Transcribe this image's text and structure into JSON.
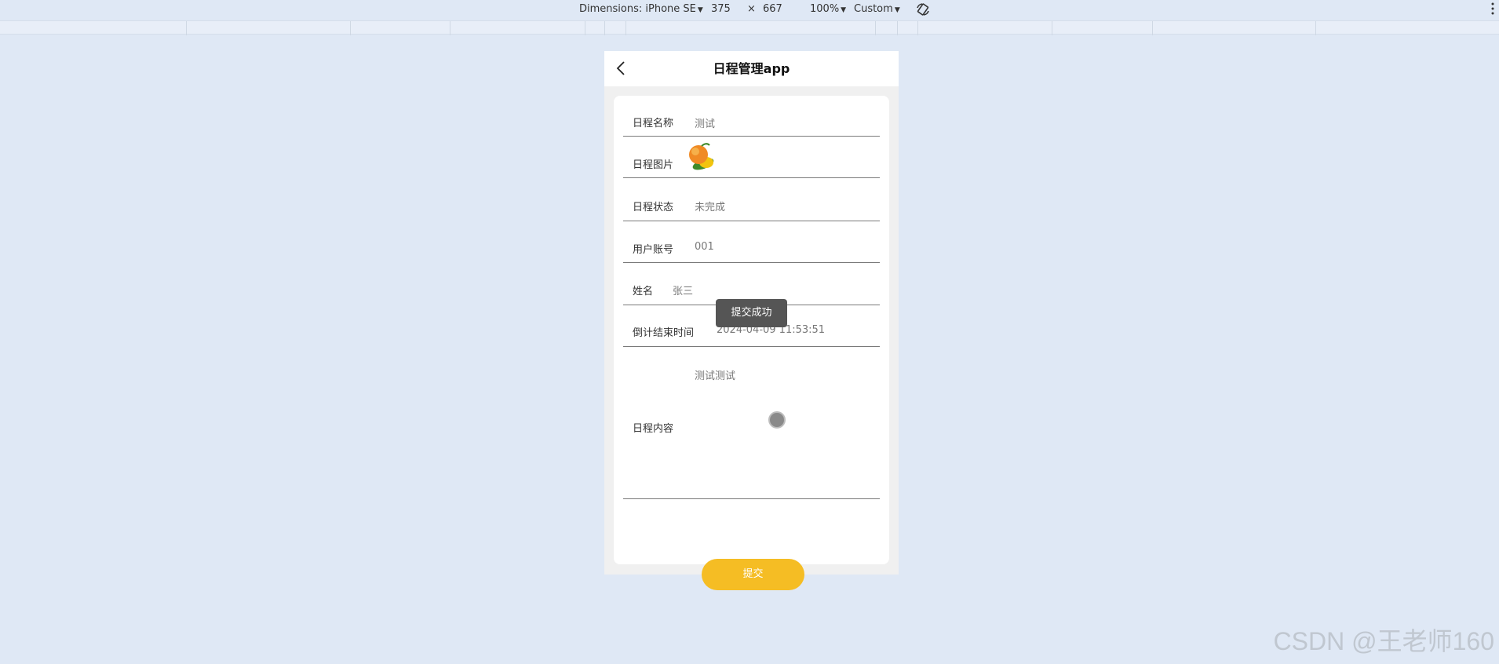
{
  "devtools": {
    "dimensions_label": "Dimensions: iPhone SE",
    "width": "375",
    "times": "×",
    "height": "667",
    "zoom": "100%",
    "throttle": "Custom"
  },
  "app": {
    "title": "日程管理app",
    "fields": {
      "name": {
        "label": "日程名称",
        "value": "测试"
      },
      "image": {
        "label": "日程图片"
      },
      "status": {
        "label": "日程状态",
        "value": "未完成"
      },
      "account": {
        "label": "用户账号",
        "value": "001"
      },
      "username": {
        "label": "姓名",
        "value": "张三"
      },
      "end_time": {
        "label": "倒计结束时间",
        "value": "2024-04-09 11:53:51"
      },
      "content": {
        "label": "日程内容",
        "value": "测试测试"
      }
    },
    "toast": "提交成功",
    "submit_label": "提交"
  },
  "watermark": "CSDN @王老师160",
  "colors": {
    "accent": "#f5bd24",
    "page_bg": "#dfe8f5",
    "toast_bg": "#555555"
  }
}
